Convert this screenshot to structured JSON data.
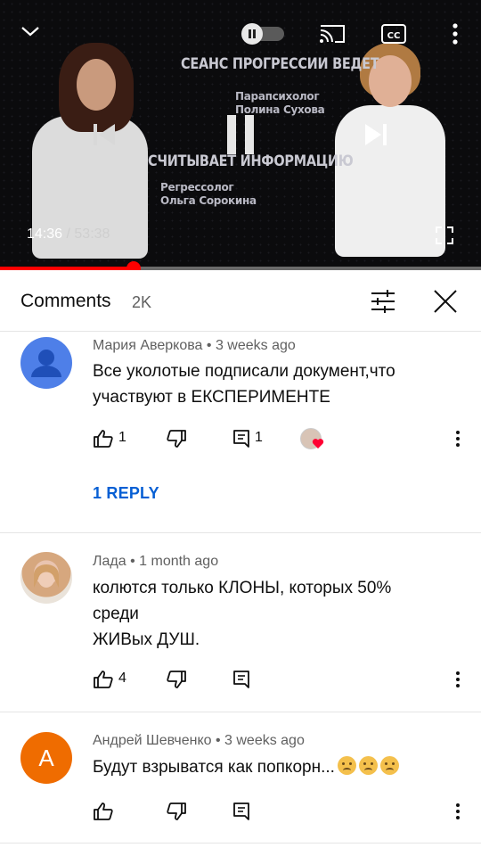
{
  "player": {
    "title_line1": "СЕАНС ПРОГРЕССИИ ВЕДЕТ",
    "speaker1": [
      "Парапсихолог",
      "Полина Сухова"
    ],
    "title_line2": "СЧИТЫВАЕТ ИНФОРМАЦИЮ",
    "speaker2": [
      "Регрессолог",
      "Ольга Сорокина"
    ],
    "current_time": "14:36",
    "separator": " / ",
    "duration": "53:38",
    "progress": 0.278,
    "icons": [
      "chevron-down-icon",
      "autoplay-toggle-icon",
      "cast-icon",
      "captions-icon",
      "more-vert-icon",
      "previous-icon",
      "pause-icon",
      "next-icon",
      "fullscreen-icon"
    ],
    "colors": {
      "progress": "#ff0000",
      "track": "#6b6b6b"
    }
  },
  "comments_header": {
    "title": "Comments",
    "count": "2K",
    "icons": [
      "filter-icon",
      "close-icon"
    ]
  },
  "comments": [
    {
      "author": "Мария Аверкова",
      "dot": " • ",
      "age": "3 weeks ago",
      "lines": [
        "Все уколотые подписали документ,что",
        "участвуют в ЕКСПЕРИМЕНТЕ"
      ],
      "likes": "1",
      "replies_count": "1",
      "reply_link": "1 REPLY",
      "avatar": "default-person-icon"
    },
    {
      "author": "Лада",
      "dot": " • ",
      "age": "1 month ago",
      "lines": [
        "колются только КЛОНЫ, которых 50%",
        "среди",
        "ЖИВых ДУШ."
      ],
      "likes": "4",
      "avatar": "photo-avatar"
    },
    {
      "author": "Андрей Шевченко",
      "dot": " • ",
      "age": "3 weeks ago",
      "text": "Будут взрыватся как попкорн...",
      "emojis": [
        "sad-face-emoji",
        "sad-face-emoji",
        "sad-face-emoji"
      ],
      "avatar_letter": "А",
      "avatar_color": "#ef6c00"
    }
  ],
  "colors": {
    "link": "#065fd4",
    "meta": "#606060",
    "avatar_blue": "#4e7fe8"
  }
}
